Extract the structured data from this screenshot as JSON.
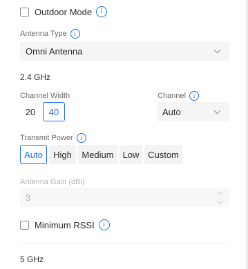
{
  "outdoor_mode": {
    "label": "Outdoor Mode",
    "checked": false
  },
  "antenna_type": {
    "label": "Antenna Type",
    "value": "Omni Antenna"
  },
  "band_24": {
    "title": "2.4 GHz",
    "channel_width": {
      "label": "Channel Width",
      "options": [
        "20",
        "40"
      ],
      "selected": "40"
    },
    "channel": {
      "label": "Channel",
      "value": "Auto"
    },
    "transmit_power": {
      "label": "Transmit Power",
      "options": [
        "Auto",
        "High",
        "Medium",
        "Low",
        "Custom"
      ],
      "selected": "Auto"
    },
    "antenna_gain": {
      "label": "Antenna Gain (dBi)",
      "value": "3",
      "disabled": true
    },
    "minimum_rssi": {
      "label": "Minimum RSSI",
      "checked": false
    }
  },
  "band_5": {
    "title": "5 GHz"
  },
  "colors": {
    "accent": "#1a73e8",
    "field_bg": "#f5f5f5",
    "muted_text": "#6b6b6b"
  }
}
